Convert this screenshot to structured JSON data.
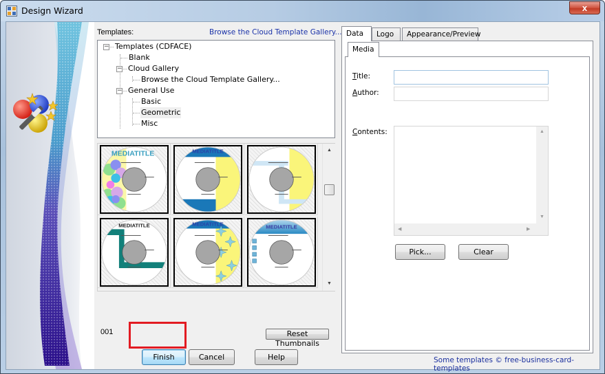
{
  "window": {
    "title": "Design Wizard",
    "close_label": "x"
  },
  "templates": {
    "label": "Templates:",
    "cloud_link": "Browse the Cloud Template Gallery...",
    "tree": [
      {
        "label": "Templates (CDFACE)",
        "level": 0,
        "expander": "−"
      },
      {
        "label": "Blank",
        "level": 1
      },
      {
        "label": "Cloud Gallery",
        "level": 1,
        "expander": "−"
      },
      {
        "label": "Browse the Cloud Template Gallery...",
        "level": 2
      },
      {
        "label": "General Use",
        "level": 1,
        "expander": "−"
      },
      {
        "label": "Basic",
        "level": 2
      },
      {
        "label": "Geometric",
        "level": 2,
        "selected": true
      },
      {
        "label": "Misc",
        "level": 2
      }
    ],
    "thumbnails": [
      {
        "title": "MEDIATITLE",
        "style": "bubbles"
      },
      {
        "title": "MEDIATITLE",
        "style": "blue-bands-yellow"
      },
      {
        "title": "",
        "style": "yellow-light-blue"
      },
      {
        "title": "MEDIATITLE",
        "style": "teal-bar"
      },
      {
        "title": "MEDIATITLE",
        "style": "blue-top-stars"
      },
      {
        "title": "MEDIATITLE",
        "style": "blue-arc-squares"
      }
    ],
    "scroll_up": "▲",
    "scroll_down": "▼",
    "page_number": "001",
    "reset_thumbnails_label": "Reset Thumbnails"
  },
  "buttons": {
    "finish": "Finish",
    "cancel": "Cancel",
    "help": "Help"
  },
  "tabs": {
    "items": [
      {
        "label": "Data",
        "active": true
      },
      {
        "label": "Logo",
        "active": false
      },
      {
        "label": "Appearance/Preview",
        "active": false
      }
    ],
    "inner_tab": "Media"
  },
  "form": {
    "title_label_mnemonic": "T",
    "title_label_rest": "itle:",
    "title_value": "",
    "author_label_mnemonic": "A",
    "author_label_rest": "uthor:",
    "author_value": "",
    "contents_label_mnemonic": "C",
    "contents_label_rest": "ontents:",
    "contents_value": "",
    "pick_label": "Pick...",
    "clear_label": "Clear"
  },
  "footer": {
    "credit": "Some templates © free-business-card-templates"
  },
  "colors": {
    "link": "#1a32a8",
    "highlight": "#e21b22",
    "close_button": "#c23b26"
  }
}
